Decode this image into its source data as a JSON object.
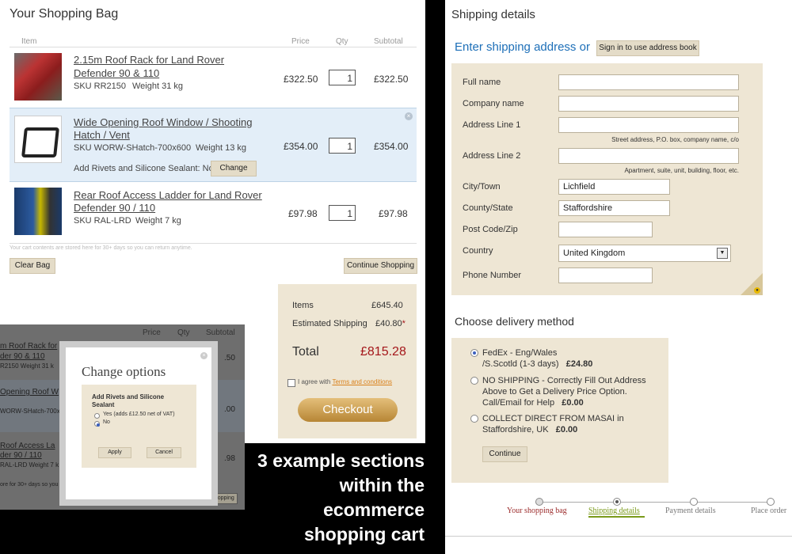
{
  "bag": {
    "title": "Your Shopping Bag",
    "columns": {
      "item": "Item",
      "price": "Price",
      "qty": "Qty",
      "subtotal": "Subtotal"
    },
    "items": [
      {
        "name_line1": "2.15m Roof Rack for Land Rover",
        "name_line2": "Defender 90 & 110",
        "sku": "SKU RR2150",
        "weight": "Weight 31 kg",
        "price": "£322.50",
        "qty": "1",
        "subtotal": "£322.50"
      },
      {
        "name_line1": "Wide Opening Roof Window / Shooting",
        "name_line2": "Hatch / Vent",
        "sku": "SKU WORW-SHatch-700x600",
        "weight": "Weight 13 kg",
        "price": "£354.00",
        "qty": "1",
        "subtotal": "£354.00",
        "option_text": "Add Rivets and Silicone Sealant: No",
        "change_label": "Change"
      },
      {
        "name_line1": "Rear Roof Access Ladder for Land Rover",
        "name_line2": "Defender 90 / 110",
        "sku": "SKU RAL-LRD",
        "weight": "Weight 7 kg",
        "price": "£97.98",
        "qty": "1",
        "subtotal": "£97.98"
      }
    ],
    "storage_note": "Your cart contents are stored here for 30+ days so you can return anytime.",
    "clear_label": "Clear Bag",
    "continue_label": "Continue Shopping",
    "summary": {
      "items_label": "Items",
      "items_value": "£645.40",
      "shipping_label": "Estimated Shipping",
      "shipping_value": "£40.80",
      "asterisk": "*",
      "total_label": "Total",
      "total_value": "£815.28",
      "agree_prefix": "I agree with",
      "terms_label": "Terms and conditions",
      "checkout_label": "Checkout"
    }
  },
  "modal": {
    "title": "Change options",
    "question": "Add Rivets and Silicone Sealant",
    "option_yes": "Yes (adds £12.50 net of VAT)",
    "option_no": "No",
    "apply_label": "Apply",
    "cancel_label": "Cancel",
    "bg_cols": {
      "price": "Price",
      "qty": "Qty",
      "subtotal": "Subtotal"
    },
    "bg_lines": [
      "m Roof Rack for",
      "der 90 & 110",
      "R2150     Weight 31 k",
      "Opening Roof W",
      "WORW-SHatch-700x6",
      "Roof Access La",
      "der 90 / 110",
      "RAL-LRD     Weight 7 k",
      "ore for 30+ days so you",
      "Continue Shopping",
      ".50",
      ".00",
      ".98"
    ]
  },
  "caption": [
    "3 example sections",
    "within the",
    "ecommerce",
    "shopping cart"
  ],
  "shipping": {
    "title": "Shipping details",
    "enter_address": "Enter shipping address or",
    "signin_label": "Sign in to use address book",
    "fields": [
      {
        "label": "Full name",
        "value": ""
      },
      {
        "label": "Company name",
        "value": ""
      },
      {
        "label": "Address Line 1",
        "value": "",
        "hint": "Street address, P.O. box, company name, c/o"
      },
      {
        "label": "Address Line 2",
        "value": "",
        "hint": "Apartment, suite, unit, building, floor, etc."
      },
      {
        "label": "City/Town",
        "value": "Lichfield"
      },
      {
        "label": "County/State",
        "value": "Staffordshire"
      },
      {
        "label": "Post Code/Zip",
        "value": ""
      },
      {
        "label": "Country",
        "value": "United Kingdom"
      },
      {
        "label": "Phone Number",
        "value": ""
      }
    ],
    "delivery_title": "Choose delivery method",
    "delivery_options": [
      {
        "line1": "FedEx - Eng/Wales",
        "line2": "/S.Scotld (1-3 days)",
        "price": "£24.80",
        "selected": true
      },
      {
        "line1": "NO SHIPPING - Correctly Fill Out Address",
        "line2": "Above to Get a Delivery Price Option.",
        "line3": "Call/Email for Help",
        "price": "£0.00",
        "selected": false
      },
      {
        "line1": "COLLECT DIRECT FROM MASAI in",
        "line2": "Staffordshire, UK",
        "price": "£0.00",
        "selected": false
      }
    ],
    "continue_label": "Continue",
    "steps": [
      "Your shopping bag",
      "Shipping details",
      "Payment details",
      "Place order"
    ]
  },
  "colors": {
    "accent_blue": "#1d6fb8",
    "total_red": "#a4161a",
    "terms_orange": "#d9801a",
    "checkout_gold": "#c99a4a",
    "step_active_green": "#7a9a1a",
    "step_done_red": "#9b2a2a"
  }
}
